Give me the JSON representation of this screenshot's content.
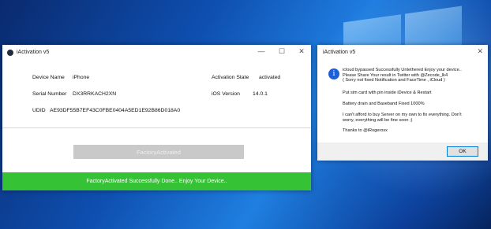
{
  "app": {
    "title": "iActivation v5",
    "controls": {
      "minimize": "—",
      "maximize": "☐",
      "close": "✕"
    },
    "device_name_label": "Device Name",
    "device_name_value": "iPhone",
    "activation_state_label": "Activation State",
    "activation_state_value": "activated",
    "serial_label": "Serial Number",
    "serial_value": "DX3RRKACH2XN",
    "ios_label": "iOS Version",
    "ios_value": "14.0.1",
    "udid_label": "UDID",
    "udid_value": "AE93DF55B7EF43C0FBE0404A5ED1E92B86D018A0",
    "button_label": "FactoryActivated",
    "status": "FactoryActivated Successfully Done.. Enjoy Your Device.."
  },
  "dialog": {
    "title": "iActivation v5",
    "close": "✕",
    "icon": "info-icon",
    "icon_glyph": "i",
    "line1": "icloud bypassed Successfully Untethered  Enjoy your device..",
    "line2": "Please Share Your result in Twitter with @Zecode_lk4",
    "line3": "( Sorry not fixed Notification and FaceTime , iCloud )",
    "line4": "Put sim card with pin inside iDevice & Restart",
    "line5": "Battery drain and Baseband Fixed 1000%",
    "line6": "I can't afford to buy Server on my own to fix everything. Don't",
    "line7": "worry, everything will be fine soon ;)",
    "line8": "Thanks to @iRogerosx",
    "ok_label": "OK"
  },
  "colors": {
    "status_green": "#35c235",
    "button_gray": "#c9c9c9",
    "info_blue": "#1d5fd6",
    "desktop_blue": "#0e4fb0"
  }
}
